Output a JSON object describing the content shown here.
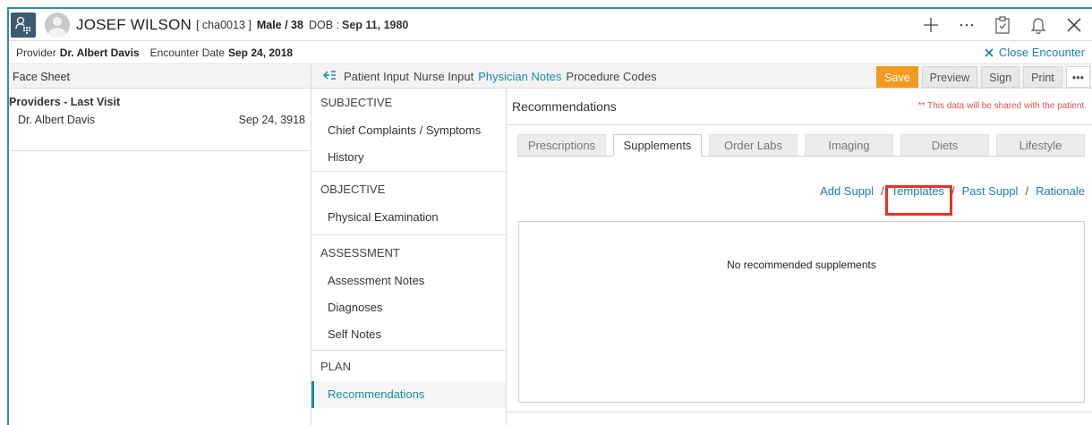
{
  "patient": {
    "name": "JOSEF WILSON",
    "id": "[ cha0013 ]",
    "sex_age": "Male / 38",
    "dob_label": "DOB :",
    "dob": "Sep 11, 1980"
  },
  "encounter": {
    "provider_label": "Provider",
    "provider": "Dr. Albert Davis",
    "date_label": "Encounter Date",
    "date": "Sep 24, 2018",
    "close_label": "Close Encounter"
  },
  "facesheet": {
    "title": "Face Sheet",
    "section": "Providers - Last Visit",
    "provider": "Dr. Albert Davis",
    "visit_date": "Sep 24, 3918"
  },
  "tabs": {
    "items": [
      "Patient Input",
      "Nurse Input",
      "Physician Notes",
      "Procedure Codes"
    ],
    "active": "Physician Notes"
  },
  "toolbar": {
    "save": "Save",
    "preview": "Preview",
    "sign": "Sign",
    "print": "Print",
    "more": "•••"
  },
  "notes_nav": {
    "subjective": "SUBJECTIVE",
    "chief": "Chief Complaints / Symptoms",
    "history": "History",
    "objective": "OBJECTIVE",
    "physical": "Physical Examination",
    "assessment": "ASSESSMENT",
    "assessment_notes": "Assessment Notes",
    "diagnoses": "Diagnoses",
    "self_notes": "Self Notes",
    "plan": "PLAN",
    "recommendations": "Recommendations"
  },
  "main": {
    "title": "Recommendations",
    "shared_note": "** This data will be shared with the patient.",
    "subtabs": [
      "Prescriptions",
      "Supplements",
      "Order Labs",
      "Imaging",
      "Diets",
      "Lifestyle"
    ],
    "active_subtab": "Supplements",
    "links": {
      "add": "Add Suppl",
      "templates": "Templates",
      "past": "Past Suppl",
      "rationale": "Rationale",
      "separator": "/"
    },
    "empty_message": "No recommended supplements"
  },
  "colors": {
    "accent": "#1a8aa8",
    "save": "#f39a1e",
    "highlight": "#e8321f",
    "warning": "#d9534f"
  }
}
